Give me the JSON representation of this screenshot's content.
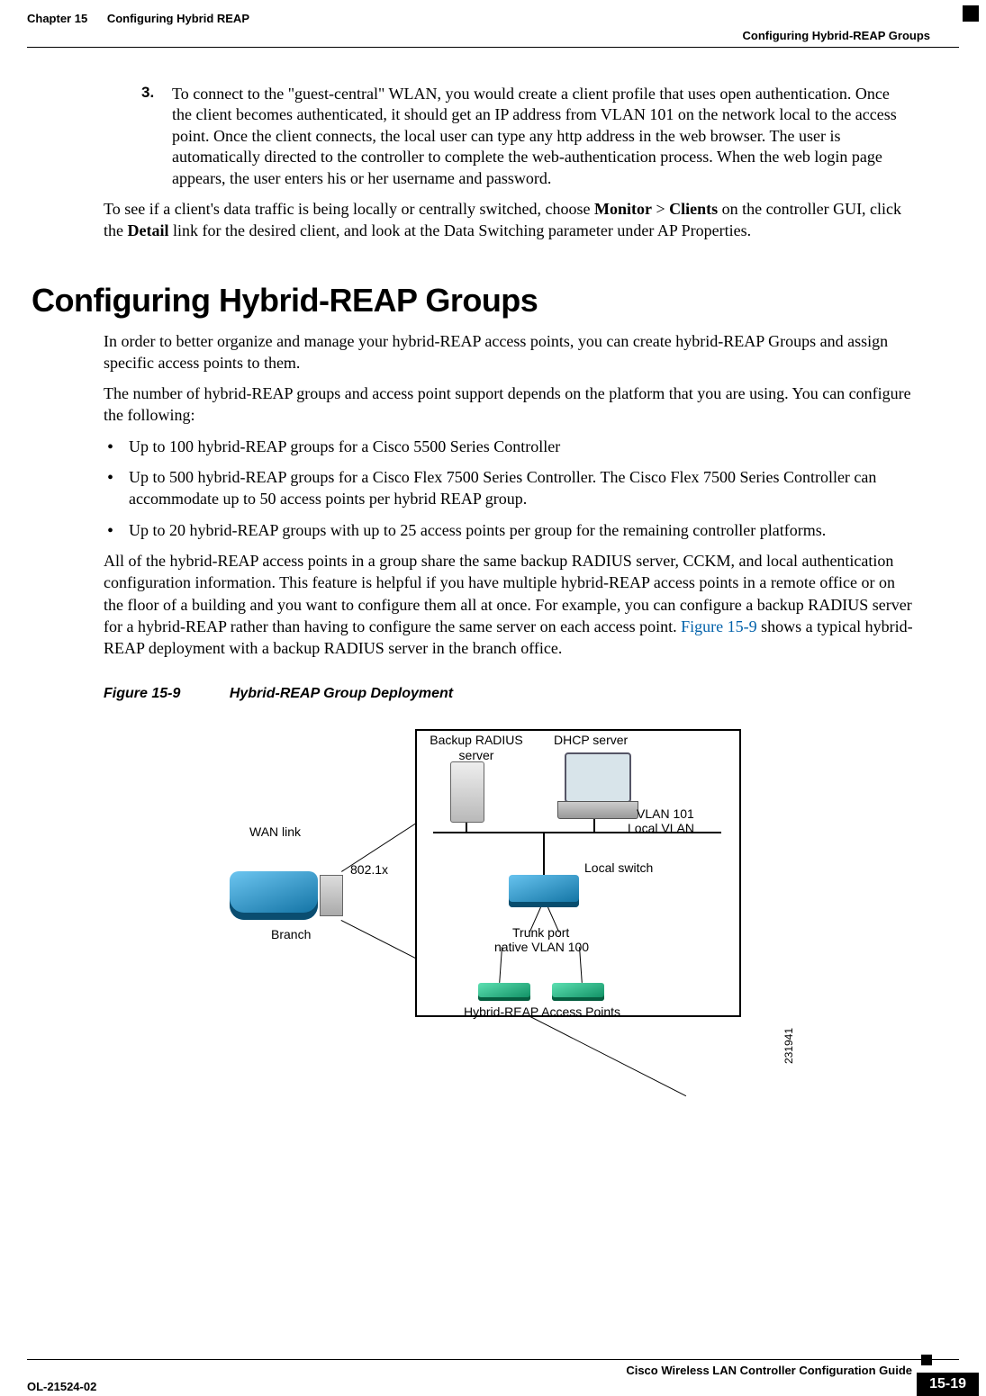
{
  "header": {
    "chapter_label": "Chapter 15",
    "chapter_title": "Configuring Hybrid REAP",
    "section_crumb": "Configuring Hybrid-REAP Groups"
  },
  "step": {
    "num": "3.",
    "text": "To connect to the \"guest-central\" WLAN, you would create a client profile that uses open authentication. Once the client becomes authenticated, it should get an IP address from VLAN 101 on the network local to the access point. Once the client connects, the local user can type any http address in the web browser. The user is automatically directed to the controller to complete the web-authentication process. When the web login page appears, the user enters his or her username and password."
  },
  "follow_para": {
    "pre": "To see if a client's data traffic is being locally or centrally switched, choose ",
    "bold1": "Monitor",
    "gt": " > ",
    "bold2": "Clients",
    "mid": " on the controller GUI, click the ",
    "bold3": "Detail",
    "post": " link for the desired client, and look at the Data Switching parameter under AP Properties."
  },
  "section_title": "Configuring Hybrid-REAP Groups",
  "intro1": "In order to better organize and manage your hybrid-REAP access points, you can create hybrid-REAP Groups and assign specific access points to them.",
  "intro2": "The number of hybrid-REAP groups and access point support depends on the platform that you are using. You can configure the following:",
  "bullets": [
    "Up to 100 hybrid-REAP groups for a Cisco 5500 Series Controller",
    "Up to 500 hybrid-REAP groups for a Cisco Flex 7500 Series Controller. The Cisco Flex 7500 Series Controller can accommodate up to 50 access points per hybrid REAP group.",
    "Up to 20 hybrid-REAP groups with up to 25 access points per group for the remaining controller platforms."
  ],
  "after_bullets": {
    "pre": "All of the hybrid-REAP access points in a group share the same backup RADIUS server, CCKM, and local authentication configuration information. This feature is helpful if you have multiple hybrid-REAP access points in a remote office or on the floor of a building and you want to configure them all at once. For example, you can configure a backup RADIUS server for a hybrid-REAP rather than having to configure the same server on each access point. ",
    "link": "Figure 15-9",
    "post": " shows a typical hybrid-REAP deployment with a backup RADIUS server in the branch office."
  },
  "figure": {
    "num": "Figure 15-9",
    "title": "Hybrid-REAP Group Deployment",
    "labels": {
      "wan": "WAN link",
      "dot1x": "802.1x",
      "branch": "Branch",
      "radius": "Backup RADIUS\nserver",
      "dhcp": "DHCP server",
      "vlan101a": "VLAN 101",
      "vlan101b": "Local VLAN",
      "localswitch": "Local switch",
      "trunk1": "Trunk port",
      "trunk2": "native VLAN 100",
      "aps": "Hybrid-REAP Access Points",
      "id": "231941"
    }
  },
  "footer": {
    "book": "Cisco Wireless LAN Controller Configuration Guide",
    "docnum": "OL-21524-02",
    "pagenum": "15-19"
  }
}
